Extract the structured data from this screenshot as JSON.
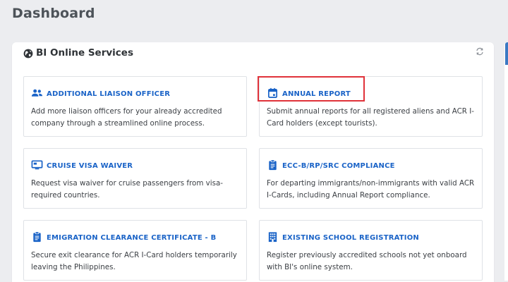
{
  "page": {
    "title": "Dashboard"
  },
  "panel": {
    "title": "BI Online Services",
    "globe_icon": "globe-icon",
    "refresh_icon": "refresh-icon"
  },
  "services": [
    {
      "title": "ADDITIONAL LIAISON OFFICER",
      "description": "Add more liaison officers for your already accredited company through a streamlined online process.",
      "icon": "users-icon"
    },
    {
      "title": "ANNUAL REPORT",
      "description": "Submit annual reports for all registered aliens and ACR I-Card holders (except tourists).",
      "icon": "calendar-icon"
    },
    {
      "title": "CRUISE VISA WAIVER",
      "description": "Request visa waiver for cruise passengers from visa-required countries.",
      "icon": "display-icon"
    },
    {
      "title": "ECC-B/RP/SRC COMPLIANCE",
      "description": "For departing immigrants/non-immigrants with valid ACR I-Cards, including Annual Report compliance.",
      "icon": "clipboard-icon"
    },
    {
      "title": "EMIGRATION CLEARANCE CERTIFICATE - B",
      "description": "Secure exit clearance for ACR I-Card holders temporarily leaving the Philippines.",
      "icon": "clipboard-icon"
    },
    {
      "title": "EXISTING SCHOOL REGISTRATION",
      "description": "Register previously accredited schools not yet onboard with BI's online system.",
      "icon": "building-icon"
    }
  ],
  "colors": {
    "link": "#1a63c7",
    "icon": "#1a63c7",
    "highlight": "#e0323a",
    "background": "#ecedf0"
  }
}
